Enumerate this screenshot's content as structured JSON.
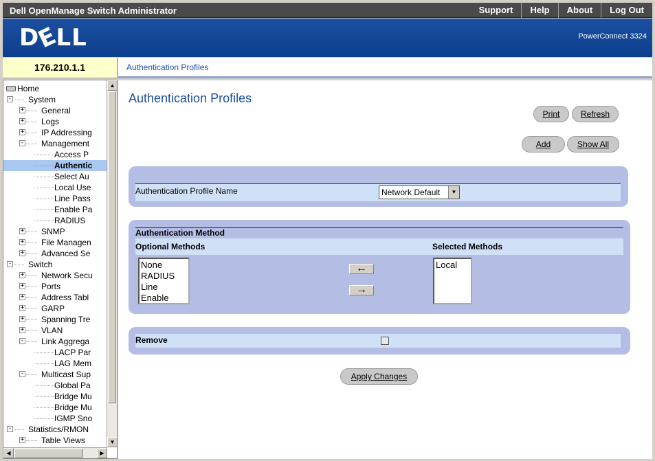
{
  "header": {
    "app_title": "Dell OpenManage Switch Administrator",
    "nav": [
      "Support",
      "Help",
      "About",
      "Log Out"
    ]
  },
  "banner": {
    "logo": "DØLL",
    "model": "PowerConnect 3324"
  },
  "ip_address": "176.210.1.1",
  "breadcrumb": "Authentication Profiles",
  "tree": {
    "items": [
      {
        "label": "Home",
        "level": 0
      },
      {
        "label": "System",
        "level": 1
      },
      {
        "label": "General",
        "level": 2
      },
      {
        "label": "Logs",
        "level": 2
      },
      {
        "label": "IP Addressing",
        "level": 2
      },
      {
        "label": "Management",
        "level": 2
      },
      {
        "label": "Access P",
        "level": 3
      },
      {
        "label": "Authentic",
        "level": 3
      },
      {
        "label": "Select Au",
        "level": 3
      },
      {
        "label": "Local Use",
        "level": 3
      },
      {
        "label": "Line Pass",
        "level": 3
      },
      {
        "label": "Enable Pa",
        "level": 3
      },
      {
        "label": "RADIUS",
        "level": 3
      },
      {
        "label": "SNMP",
        "level": 2
      },
      {
        "label": "File Managen",
        "level": 2
      },
      {
        "label": "Advanced Se",
        "level": 2
      },
      {
        "label": "Switch",
        "level": 1
      },
      {
        "label": "Network Secu",
        "level": 2
      },
      {
        "label": "Ports",
        "level": 2
      },
      {
        "label": "Address Tabl",
        "level": 2
      },
      {
        "label": "GARP",
        "level": 2
      },
      {
        "label": "Spanning Tre",
        "level": 2
      },
      {
        "label": "VLAN",
        "level": 2
      },
      {
        "label": "Link Aggrega",
        "level": 2
      },
      {
        "label": "LACP Par",
        "level": 3
      },
      {
        "label": "LAG Mem",
        "level": 3
      },
      {
        "label": "Multicast Sup",
        "level": 2
      },
      {
        "label": "Global Pa",
        "level": 3
      },
      {
        "label": "Bridge Mu",
        "level": 3
      },
      {
        "label": "Bridge Mu",
        "level": 3
      },
      {
        "label": "IGMP Sno",
        "level": 3
      },
      {
        "label": "Statistics/RMON",
        "level": 1
      },
      {
        "label": "Table Views",
        "level": 2
      }
    ]
  },
  "main": {
    "title": "Authentication Profiles",
    "buttons": {
      "print": "Print",
      "refresh": "Refresh",
      "add": "Add",
      "show_all": "Show All",
      "apply": "Apply Changes"
    },
    "profile": {
      "label": "Authentication Profile Name",
      "value": "Network Default"
    },
    "method": {
      "heading": "Authentication Method",
      "optional_heading": "Optional Methods",
      "selected_heading": "Selected Methods",
      "optional": [
        "None",
        "RADIUS",
        "Line",
        "Enable"
      ],
      "selected": [
        "Local"
      ],
      "move_left": "←",
      "move_right": "→"
    },
    "remove": {
      "label": "Remove",
      "checked": false
    }
  }
}
